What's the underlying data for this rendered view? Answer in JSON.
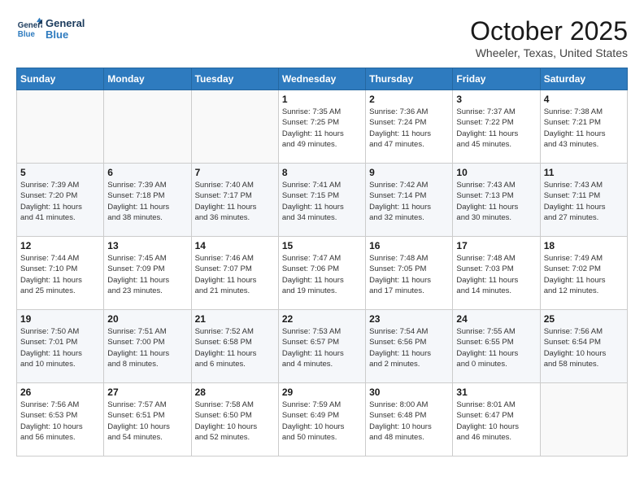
{
  "logo": {
    "line1": "General",
    "line2": "Blue"
  },
  "header": {
    "month_title": "October 2025",
    "location": "Wheeler, Texas, United States"
  },
  "days_of_week": [
    "Sunday",
    "Monday",
    "Tuesday",
    "Wednesday",
    "Thursday",
    "Friday",
    "Saturday"
  ],
  "weeks": [
    [
      {
        "day": "",
        "info": ""
      },
      {
        "day": "",
        "info": ""
      },
      {
        "day": "",
        "info": ""
      },
      {
        "day": "1",
        "info": "Sunrise: 7:35 AM\nSunset: 7:25 PM\nDaylight: 11 hours\nand 49 minutes."
      },
      {
        "day": "2",
        "info": "Sunrise: 7:36 AM\nSunset: 7:24 PM\nDaylight: 11 hours\nand 47 minutes."
      },
      {
        "day": "3",
        "info": "Sunrise: 7:37 AM\nSunset: 7:22 PM\nDaylight: 11 hours\nand 45 minutes."
      },
      {
        "day": "4",
        "info": "Sunrise: 7:38 AM\nSunset: 7:21 PM\nDaylight: 11 hours\nand 43 minutes."
      }
    ],
    [
      {
        "day": "5",
        "info": "Sunrise: 7:39 AM\nSunset: 7:20 PM\nDaylight: 11 hours\nand 41 minutes."
      },
      {
        "day": "6",
        "info": "Sunrise: 7:39 AM\nSunset: 7:18 PM\nDaylight: 11 hours\nand 38 minutes."
      },
      {
        "day": "7",
        "info": "Sunrise: 7:40 AM\nSunset: 7:17 PM\nDaylight: 11 hours\nand 36 minutes."
      },
      {
        "day": "8",
        "info": "Sunrise: 7:41 AM\nSunset: 7:15 PM\nDaylight: 11 hours\nand 34 minutes."
      },
      {
        "day": "9",
        "info": "Sunrise: 7:42 AM\nSunset: 7:14 PM\nDaylight: 11 hours\nand 32 minutes."
      },
      {
        "day": "10",
        "info": "Sunrise: 7:43 AM\nSunset: 7:13 PM\nDaylight: 11 hours\nand 30 minutes."
      },
      {
        "day": "11",
        "info": "Sunrise: 7:43 AM\nSunset: 7:11 PM\nDaylight: 11 hours\nand 27 minutes."
      }
    ],
    [
      {
        "day": "12",
        "info": "Sunrise: 7:44 AM\nSunset: 7:10 PM\nDaylight: 11 hours\nand 25 minutes."
      },
      {
        "day": "13",
        "info": "Sunrise: 7:45 AM\nSunset: 7:09 PM\nDaylight: 11 hours\nand 23 minutes."
      },
      {
        "day": "14",
        "info": "Sunrise: 7:46 AM\nSunset: 7:07 PM\nDaylight: 11 hours\nand 21 minutes."
      },
      {
        "day": "15",
        "info": "Sunrise: 7:47 AM\nSunset: 7:06 PM\nDaylight: 11 hours\nand 19 minutes."
      },
      {
        "day": "16",
        "info": "Sunrise: 7:48 AM\nSunset: 7:05 PM\nDaylight: 11 hours\nand 17 minutes."
      },
      {
        "day": "17",
        "info": "Sunrise: 7:48 AM\nSunset: 7:03 PM\nDaylight: 11 hours\nand 14 minutes."
      },
      {
        "day": "18",
        "info": "Sunrise: 7:49 AM\nSunset: 7:02 PM\nDaylight: 11 hours\nand 12 minutes."
      }
    ],
    [
      {
        "day": "19",
        "info": "Sunrise: 7:50 AM\nSunset: 7:01 PM\nDaylight: 11 hours\nand 10 minutes."
      },
      {
        "day": "20",
        "info": "Sunrise: 7:51 AM\nSunset: 7:00 PM\nDaylight: 11 hours\nand 8 minutes."
      },
      {
        "day": "21",
        "info": "Sunrise: 7:52 AM\nSunset: 6:58 PM\nDaylight: 11 hours\nand 6 minutes."
      },
      {
        "day": "22",
        "info": "Sunrise: 7:53 AM\nSunset: 6:57 PM\nDaylight: 11 hours\nand 4 minutes."
      },
      {
        "day": "23",
        "info": "Sunrise: 7:54 AM\nSunset: 6:56 PM\nDaylight: 11 hours\nand 2 minutes."
      },
      {
        "day": "24",
        "info": "Sunrise: 7:55 AM\nSunset: 6:55 PM\nDaylight: 11 hours\nand 0 minutes."
      },
      {
        "day": "25",
        "info": "Sunrise: 7:56 AM\nSunset: 6:54 PM\nDaylight: 10 hours\nand 58 minutes."
      }
    ],
    [
      {
        "day": "26",
        "info": "Sunrise: 7:56 AM\nSunset: 6:53 PM\nDaylight: 10 hours\nand 56 minutes."
      },
      {
        "day": "27",
        "info": "Sunrise: 7:57 AM\nSunset: 6:51 PM\nDaylight: 10 hours\nand 54 minutes."
      },
      {
        "day": "28",
        "info": "Sunrise: 7:58 AM\nSunset: 6:50 PM\nDaylight: 10 hours\nand 52 minutes."
      },
      {
        "day": "29",
        "info": "Sunrise: 7:59 AM\nSunset: 6:49 PM\nDaylight: 10 hours\nand 50 minutes."
      },
      {
        "day": "30",
        "info": "Sunrise: 8:00 AM\nSunset: 6:48 PM\nDaylight: 10 hours\nand 48 minutes."
      },
      {
        "day": "31",
        "info": "Sunrise: 8:01 AM\nSunset: 6:47 PM\nDaylight: 10 hours\nand 46 minutes."
      },
      {
        "day": "",
        "info": ""
      }
    ]
  ]
}
